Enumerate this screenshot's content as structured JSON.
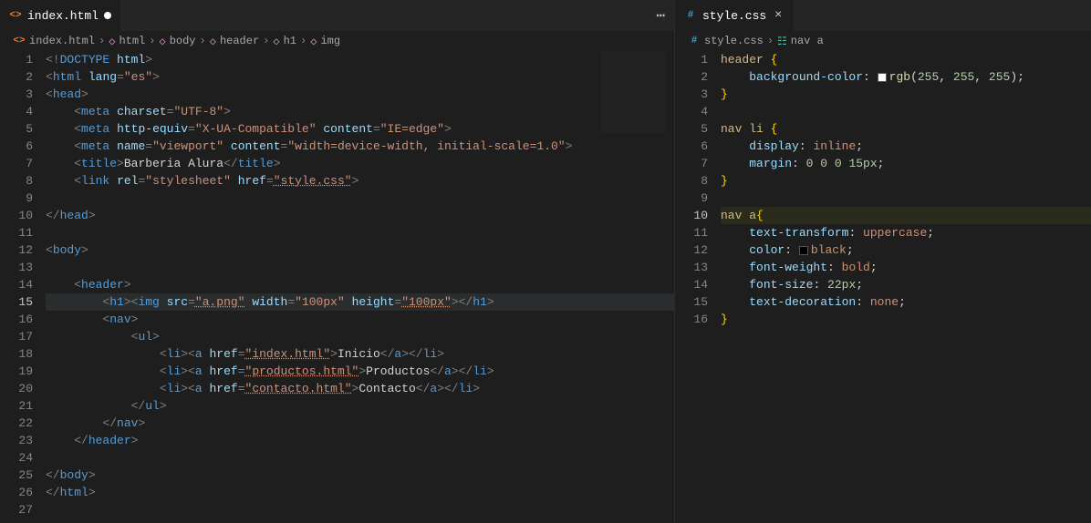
{
  "left": {
    "tab": {
      "label": "index.html",
      "modified": true
    },
    "breadcrumbs": [
      "index.html",
      "html",
      "body",
      "header",
      "h1",
      "img"
    ],
    "code": {
      "activeLine": 15,
      "lines": [
        {
          "n": 1,
          "html": "<span class='t-tag'>&lt;!</span><span class='t-name'>DOCTYPE</span> <span class='t-attr'>html</span><span class='t-tag'>&gt;</span>"
        },
        {
          "n": 2,
          "html": "<span class='t-tag'>&lt;</span><span class='t-name'>html</span> <span class='t-attr'>lang</span><span class='t-tag'>=</span><span class='t-str'>\"es\"</span><span class='t-tag'>&gt;</span>"
        },
        {
          "n": 3,
          "html": "<span class='t-tag'>&lt;</span><span class='t-name'>head</span><span class='t-tag'>&gt;</span>"
        },
        {
          "n": 4,
          "html": "    <span class='t-tag'>&lt;</span><span class='t-name'>meta</span> <span class='t-attr'>charset</span><span class='t-tag'>=</span><span class='t-str'>\"UTF-8\"</span><span class='t-tag'>&gt;</span>"
        },
        {
          "n": 5,
          "html": "    <span class='t-tag'>&lt;</span><span class='t-name'>meta</span> <span class='t-attr'>http-equiv</span><span class='t-tag'>=</span><span class='t-str'>\"X-UA-Compatible\"</span> <span class='t-attr'>content</span><span class='t-tag'>=</span><span class='t-str'>\"IE=edge\"</span><span class='t-tag'>&gt;</span>"
        },
        {
          "n": 6,
          "html": "    <span class='t-tag'>&lt;</span><span class='t-name'>meta</span> <span class='t-attr'>name</span><span class='t-tag'>=</span><span class='t-str'>\"viewport\"</span> <span class='t-attr'>content</span><span class='t-tag'>=</span><span class='t-str'>\"width=device-width, initial-scale=1.0\"</span><span class='t-tag'>&gt;</span>"
        },
        {
          "n": 7,
          "html": "    <span class='t-tag'>&lt;</span><span class='t-name'>title</span><span class='t-tag'>&gt;</span><span class='t-txt'>Barberia Alura</span><span class='t-tag'>&lt;/</span><span class='t-name'>title</span><span class='t-tag'>&gt;</span>"
        },
        {
          "n": 8,
          "html": "    <span class='t-tag'>&lt;</span><span class='t-name'>link</span> <span class='t-attr'>rel</span><span class='t-tag'>=</span><span class='t-str'>\"stylesheet\"</span> <span class='t-attr'>href</span><span class='t-tag'>=</span><span class='t-str u'>\"style.css\"</span><span class='t-tag'>&gt;</span>"
        },
        {
          "n": 9,
          "html": ""
        },
        {
          "n": 10,
          "html": "<span class='t-tag'>&lt;/</span><span class='t-name'>head</span><span class='t-tag'>&gt;</span>"
        },
        {
          "n": 11,
          "html": ""
        },
        {
          "n": 12,
          "html": "<span class='t-tag'>&lt;</span><span class='t-name'>body</span><span class='t-tag'>&gt;</span>"
        },
        {
          "n": 13,
          "html": ""
        },
        {
          "n": 14,
          "html": "    <span class='t-tag'>&lt;</span><span class='t-name'>header</span><span class='t-tag'>&gt;</span>"
        },
        {
          "n": 15,
          "hl": true,
          "html": "        <span class='t-tag'>&lt;</span><span class='t-name'>h1</span><span class='t-tag'>&gt;&lt;</span><span class='t-name'>img</span> <span class='t-attr'>src</span><span class='t-tag'>=</span><span class='t-str u'>\"a.png\"</span> <span class='t-attr'>width</span><span class='t-tag'>=</span><span class='t-str'>\"100px\"</span> <span class='t-attr'>height</span><span class='t-tag'>=</span><span class='t-str u'>\"100px\"</span><span class='t-tag'>&gt;&lt;/</span><span class='t-name'>h1</span><span class='t-tag'>&gt;</span>"
        },
        {
          "n": 16,
          "html": "        <span class='t-tag'>&lt;</span><span class='t-name'>nav</span><span class='t-tag'>&gt;</span>"
        },
        {
          "n": 17,
          "html": "            <span class='t-tag'>&lt;</span><span class='t-name'>ul</span><span class='t-tag'>&gt;</span>"
        },
        {
          "n": 18,
          "html": "                <span class='t-tag'>&lt;</span><span class='t-name'>li</span><span class='t-tag'>&gt;&lt;</span><span class='t-name'>a</span> <span class='t-attr'>href</span><span class='t-tag'>=</span><span class='t-str u'>\"index.html\"</span><span class='t-tag'>&gt;</span><span class='t-txt'>Inicio</span><span class='t-tag'>&lt;/</span><span class='t-name'>a</span><span class='t-tag'>&gt;&lt;/</span><span class='t-name'>li</span><span class='t-tag'>&gt;</span>"
        },
        {
          "n": 19,
          "html": "                <span class='t-tag'>&lt;</span><span class='t-name'>li</span><span class='t-tag'>&gt;&lt;</span><span class='t-name'>a</span> <span class='t-attr'>href</span><span class='t-tag'>=</span><span class='t-str u'>\"productos.html\"</span><span class='t-tag'>&gt;</span><span class='t-txt'>Productos</span><span class='t-tag'>&lt;/</span><span class='t-name'>a</span><span class='t-tag'>&gt;&lt;/</span><span class='t-name'>li</span><span class='t-tag'>&gt;</span>"
        },
        {
          "n": 20,
          "html": "                <span class='t-tag'>&lt;</span><span class='t-name'>li</span><span class='t-tag'>&gt;&lt;</span><span class='t-name'>a</span> <span class='t-attr'>href</span><span class='t-tag'>=</span><span class='t-str u'>\"contacto.html\"</span><span class='t-tag'>&gt;</span><span class='t-txt'>Contacto</span><span class='t-tag'>&lt;/</span><span class='t-name'>a</span><span class='t-tag'>&gt;&lt;/</span><span class='t-name'>li</span><span class='t-tag'>&gt;</span>"
        },
        {
          "n": 21,
          "html": "            <span class='t-tag'>&lt;/</span><span class='t-name'>ul</span><span class='t-tag'>&gt;</span>"
        },
        {
          "n": 22,
          "html": "        <span class='t-tag'>&lt;/</span><span class='t-name'>nav</span><span class='t-tag'>&gt;</span>"
        },
        {
          "n": 23,
          "html": "    <span class='t-tag'>&lt;/</span><span class='t-name'>header</span><span class='t-tag'>&gt;</span>"
        },
        {
          "n": 24,
          "html": ""
        },
        {
          "n": 25,
          "html": "<span class='t-tag'>&lt;/</span><span class='t-name'>body</span><span class='t-tag'>&gt;</span>"
        },
        {
          "n": 26,
          "html": "<span class='t-tag'>&lt;/</span><span class='t-name'>html</span><span class='t-tag'>&gt;</span>"
        },
        {
          "n": 27,
          "html": ""
        }
      ]
    }
  },
  "right": {
    "tab": {
      "label": "style.css",
      "modified": false
    },
    "breadcrumbs": [
      "style.css",
      "nav a"
    ],
    "code": {
      "activeLine": 10,
      "lines": [
        {
          "n": 1,
          "html": "<span class='t-sel'>header</span> <span class='t-brace'>{</span>"
        },
        {
          "n": 2,
          "html": "    <span class='t-prop'>background-color</span>: <span class='swatch white'></span><span class='t-func'>rgb</span>(<span class='t-num'>255</span>, <span class='t-num'>255</span>, <span class='t-num'>255</span>);"
        },
        {
          "n": 3,
          "html": "<span class='t-brace'>}</span>"
        },
        {
          "n": 4,
          "html": ""
        },
        {
          "n": 5,
          "html": "<span class='t-sel'>nav li</span> <span class='t-brace'>{</span>"
        },
        {
          "n": 6,
          "html": "    <span class='t-prop'>display</span>: <span class='t-val'>inline</span>;"
        },
        {
          "n": 7,
          "html": "    <span class='t-prop'>margin</span>: <span class='t-num'>0 0 0 15px</span>;"
        },
        {
          "n": 8,
          "html": "<span class='t-brace'>}</span>"
        },
        {
          "n": 9,
          "html": ""
        },
        {
          "n": 10,
          "hl2": true,
          "html": "<span class='t-sel'>nav a</span><span class='t-brace'>{</span>"
        },
        {
          "n": 11,
          "html": "    <span class='t-prop'>text-transform</span>: <span class='t-val'>uppercase</span>;"
        },
        {
          "n": 12,
          "html": "    <span class='t-prop'>color</span>: <span class='swatch black'></span><span class='t-val'>black</span>;"
        },
        {
          "n": 13,
          "html": "    <span class='t-prop'>font-weight</span>: <span class='t-val'>bold</span>;"
        },
        {
          "n": 14,
          "html": "    <span class='t-prop'>font-size</span>: <span class='t-num'>22px</span>;"
        },
        {
          "n": 15,
          "html": "    <span class='t-prop'>text-decoration</span>: <span class='t-val'>none</span>;"
        },
        {
          "n": 16,
          "html": "<span class='t-brace'>}</span>"
        }
      ]
    }
  }
}
